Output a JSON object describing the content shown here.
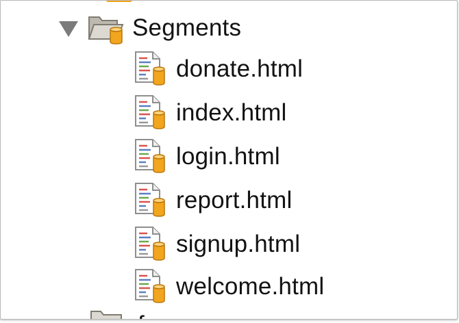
{
  "tree": {
    "folder": {
      "label": "Segments",
      "expanded": true,
      "icons": [
        "disclosure-triangle-down-icon",
        "open-folder-icon"
      ]
    },
    "files": [
      {
        "name": "donate.html",
        "icon": "html-file-icon"
      },
      {
        "name": "index.html",
        "icon": "html-file-icon"
      },
      {
        "name": "login.html",
        "icon": "html-file-icon"
      },
      {
        "name": "report.html",
        "icon": "html-file-icon"
      },
      {
        "name": "signup.html",
        "icon": "html-file-icon"
      },
      {
        "name": "welcome.html",
        "icon": "html-file-icon"
      }
    ],
    "next_item_partial": {
      "label": "f",
      "icon": "closed-folder-icon"
    }
  },
  "colors": {
    "folder_fill": "#dcd9d2",
    "cylinder_orange": "#f2a51e",
    "file_border": "#8e8e8e",
    "text": "#121212"
  }
}
